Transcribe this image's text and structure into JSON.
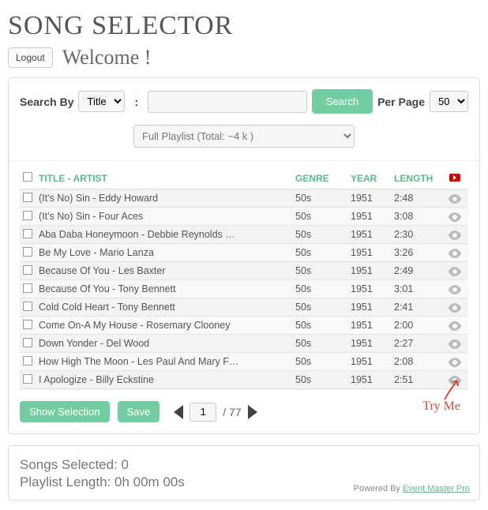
{
  "title": "SONG SELECTOR",
  "logout": "Logout",
  "welcome": "Welcome !",
  "search": {
    "label": "Search By",
    "field": "Title",
    "colon": ":",
    "value": "",
    "button": "Search",
    "per_page_label": "Per Page",
    "per_page_value": "50"
  },
  "playlist_select": "Full Playlist (Total: ~4 k )",
  "columns": {
    "title": "TITLE - ARTIST",
    "genre": "GENRE",
    "year": "YEAR",
    "length": "LENGTH"
  },
  "rows": [
    {
      "title": "(It's No) Sin - Eddy Howard",
      "genre": "50s",
      "year": "1951",
      "length": "2:48"
    },
    {
      "title": "(It's No) Sin - Four Aces",
      "genre": "50s",
      "year": "1951",
      "length": "3:08"
    },
    {
      "title": "Aba Daba Honeymoon - Debbie Reynolds …",
      "genre": "50s",
      "year": "1951",
      "length": "2:30"
    },
    {
      "title": "Be My Love - Mario Lanza",
      "genre": "50s",
      "year": "1951",
      "length": "3:26"
    },
    {
      "title": "Because Of You - Les Baxter",
      "genre": "50s",
      "year": "1951",
      "length": "2:49"
    },
    {
      "title": "Because Of You - Tony Bennett",
      "genre": "50s",
      "year": "1951",
      "length": "3:01"
    },
    {
      "title": "Cold Cold Heart - Tony Bennett",
      "genre": "50s",
      "year": "1951",
      "length": "2:41"
    },
    {
      "title": "Come On-A My House - Rosemary Clooney",
      "genre": "50s",
      "year": "1951",
      "length": "2:00"
    },
    {
      "title": "Down Yonder - Del Wood",
      "genre": "50s",
      "year": "1951",
      "length": "2:27"
    },
    {
      "title": "How High The Moon - Les Paul And Mary F…",
      "genre": "50s",
      "year": "1951",
      "length": "2:08"
    },
    {
      "title": "I Apologize - Billy Eckstine",
      "genre": "50s",
      "year": "1951",
      "length": "2:51"
    }
  ],
  "footer": {
    "show_selection": "Show Selection",
    "save": "Save",
    "page": "1",
    "total_pages": "/ 77",
    "try_me": "Try Me"
  },
  "status": {
    "songs_line": "Songs Selected: 0",
    "length_line": "Playlist Length: 0h 00m 00s",
    "powered": "Powered By ",
    "powered_link": "Event Master Pro"
  }
}
